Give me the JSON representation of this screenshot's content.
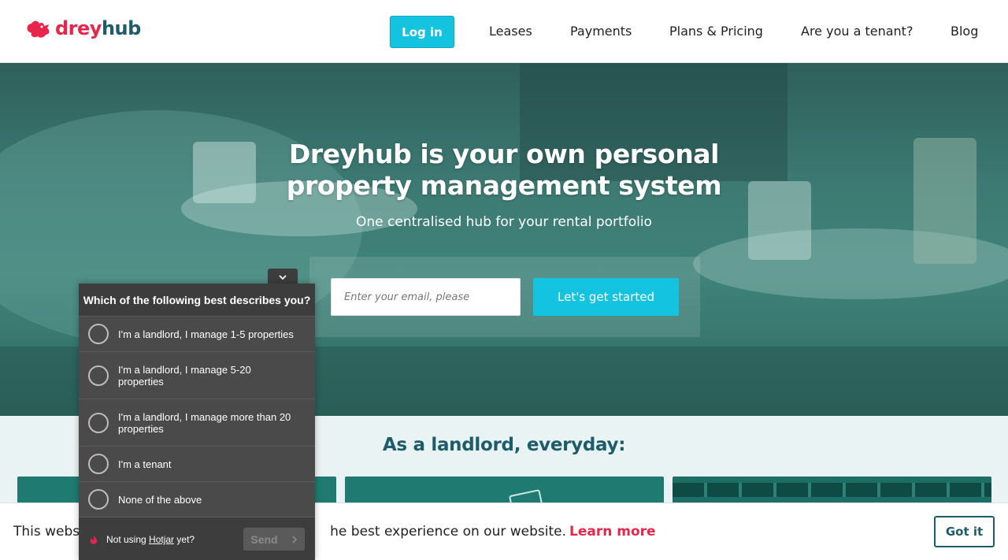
{
  "brand": {
    "logo_text_a": "drey",
    "logo_text_b": "hub",
    "accent_color": "#14c3df",
    "brand_red": "#e8264b",
    "brand_teal": "#1d5d6b"
  },
  "nav": {
    "login": "Log in",
    "items": [
      "Leases",
      "Payments",
      "Plans & Pricing",
      "Are you a tenant?",
      "Blog"
    ]
  },
  "hero": {
    "title_line1": "Dreyhub is your own personal",
    "title_line2": "property management system",
    "subtitle": "One centralised hub for your rental portfolio",
    "email_placeholder": "Enter your email, please",
    "cta": "Let's get started"
  },
  "landlord": {
    "title": "As a landlord, everyday:"
  },
  "cookie": {
    "text_visible_a": "This webs",
    "text_visible_b": "he best experience on our website.",
    "learn_more": "Learn more",
    "got_it": "Got it"
  },
  "poll": {
    "toggle_icon": "chevron-down",
    "question": "Which of the following best describes you?",
    "options": [
      "I'm a landlord, I manage 1-5 properties",
      "I'm a landlord, I manage 5-20 properties",
      "I'm a landlord, I manage more than 20 properties",
      "I'm a tenant",
      "None of the above"
    ],
    "footer_prefix": "Not using",
    "footer_link": "Hotjar",
    "footer_suffix": "yet?",
    "send": "Send"
  }
}
